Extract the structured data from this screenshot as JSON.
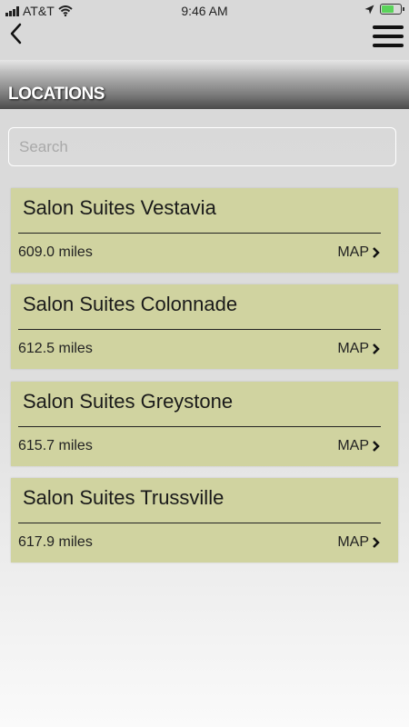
{
  "status": {
    "carrier": "AT&T",
    "time": "9:46 AM"
  },
  "header": {
    "title": "LOCATIONS"
  },
  "search": {
    "placeholder": "Search"
  },
  "locations": [
    {
      "name": "Salon Suites Vestavia",
      "distance": "609.0 miles",
      "map_label": "MAP"
    },
    {
      "name": "Salon Suites Colonnade",
      "distance": "612.5 miles",
      "map_label": "MAP"
    },
    {
      "name": "Salon Suites Greystone",
      "distance": "615.7 miles",
      "map_label": "MAP"
    },
    {
      "name": "Salon Suites Trussville",
      "distance": "617.9 miles",
      "map_label": "MAP"
    }
  ],
  "icons": {
    "signal": "signal-icon",
    "wifi": "wifi-icon",
    "location": "location-arrow-icon",
    "battery": "battery-icon",
    "back": "chevron-left-icon",
    "menu": "hamburger-menu-icon",
    "map_chevron": "chevron-right-icon"
  },
  "colors": {
    "card_background": "#d0d3a0",
    "battery_fill": "#5ad35a"
  }
}
